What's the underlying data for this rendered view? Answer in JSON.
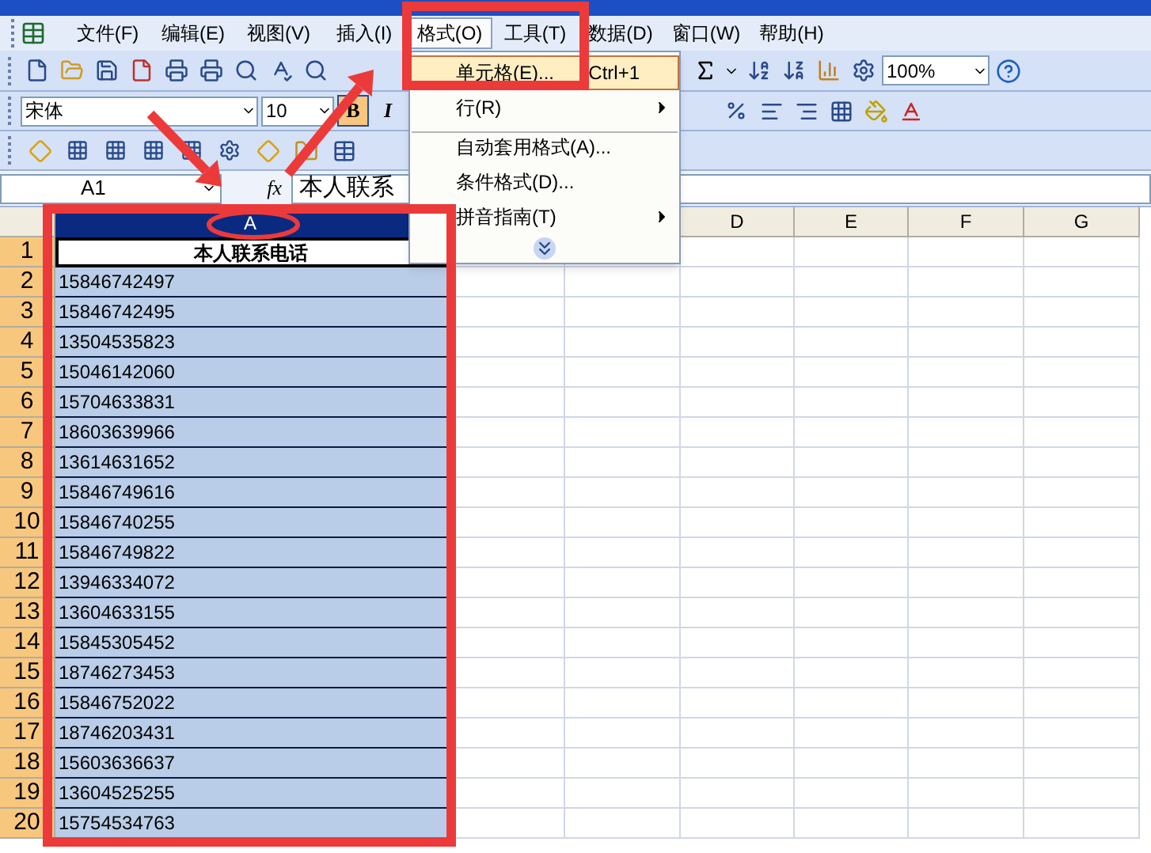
{
  "menu_bar": {
    "items": [
      {
        "label": "文件(F)",
        "selected": false
      },
      {
        "label": "编辑(E)",
        "selected": false
      },
      {
        "label": "视图(V)",
        "selected": false
      },
      {
        "label": "插入(I)",
        "selected": false
      },
      {
        "label": "格式(O)",
        "selected": true
      },
      {
        "label": "工具(T)",
        "selected": false
      },
      {
        "label": "数据(D)",
        "selected": false
      },
      {
        "label": "窗口(W)",
        "selected": false
      },
      {
        "label": "帮助(H)",
        "selected": false
      }
    ]
  },
  "standard_toolbar": {
    "zoom": "100%"
  },
  "formatting_toolbar": {
    "font": "宋体",
    "size": "10",
    "bold": {
      "label": "B",
      "on": true
    },
    "italic": {
      "label": "I",
      "on": false
    }
  },
  "formula_bar": {
    "name_box": "A1",
    "function_label": "fx",
    "formula": "本人联系"
  },
  "format_menu": {
    "items": [
      {
        "label": "单元格(E)...",
        "shortcut": "Ctrl+1",
        "selected": true,
        "submenu": false,
        "separator_before": false
      },
      {
        "label": "行(R)",
        "selected": false,
        "submenu": true,
        "separator_before": false
      },
      {
        "label": "自动套用格式(A)...",
        "selected": false,
        "submenu": false,
        "separator_before": true
      },
      {
        "label": "条件格式(D)...",
        "selected": false,
        "submenu": false,
        "separator_before": false
      },
      {
        "label": "拼音指南(T)",
        "selected": false,
        "submenu": true,
        "separator_before": false
      }
    ]
  },
  "sheet": {
    "columns": [
      {
        "label": "A",
        "selected": true
      },
      {
        "label": "D",
        "selected": false
      },
      {
        "label": "E",
        "selected": false
      },
      {
        "label": "F",
        "selected": false
      },
      {
        "label": "G",
        "selected": false
      }
    ],
    "rows": [
      {
        "number": "1",
        "value": "本人联系电话",
        "kind": "heading",
        "selected": true
      },
      {
        "number": "2",
        "value": "15846742497",
        "kind": "value",
        "selected": true
      },
      {
        "number": "3",
        "value": "15846742495",
        "kind": "value",
        "selected": true
      },
      {
        "number": "4",
        "value": "13504535823",
        "kind": "value",
        "selected": true
      },
      {
        "number": "5",
        "value": "15046142060",
        "kind": "value",
        "selected": true
      },
      {
        "number": "6",
        "value": "15704633831",
        "kind": "value",
        "selected": true
      },
      {
        "number": "7",
        "value": "18603639966",
        "kind": "value",
        "selected": true
      },
      {
        "number": "8",
        "value": "13614631652",
        "kind": "value",
        "selected": true
      },
      {
        "number": "9",
        "value": "15846749616",
        "kind": "value",
        "selected": true
      },
      {
        "number": "10",
        "value": "15846740255",
        "kind": "value",
        "selected": true
      },
      {
        "number": "11",
        "value": "15846749822",
        "kind": "value",
        "selected": true
      },
      {
        "number": "12",
        "value": "13946334072",
        "kind": "value",
        "selected": true
      },
      {
        "number": "13",
        "value": "13604633155",
        "kind": "value",
        "selected": true
      },
      {
        "number": "14",
        "value": "15845305452",
        "kind": "value",
        "selected": true
      },
      {
        "number": "15",
        "value": "18746273453",
        "kind": "value",
        "selected": true
      },
      {
        "number": "16",
        "value": "15846752022",
        "kind": "value",
        "selected": true
      },
      {
        "number": "17",
        "value": "18746203431",
        "kind": "value",
        "selected": true
      },
      {
        "number": "18",
        "value": "15603636637",
        "kind": "value",
        "selected": true
      },
      {
        "number": "19",
        "value": "13604525255",
        "kind": "value",
        "selected": true
      },
      {
        "number": "20",
        "value": "15754534763",
        "kind": "value",
        "selected": true
      }
    ]
  }
}
